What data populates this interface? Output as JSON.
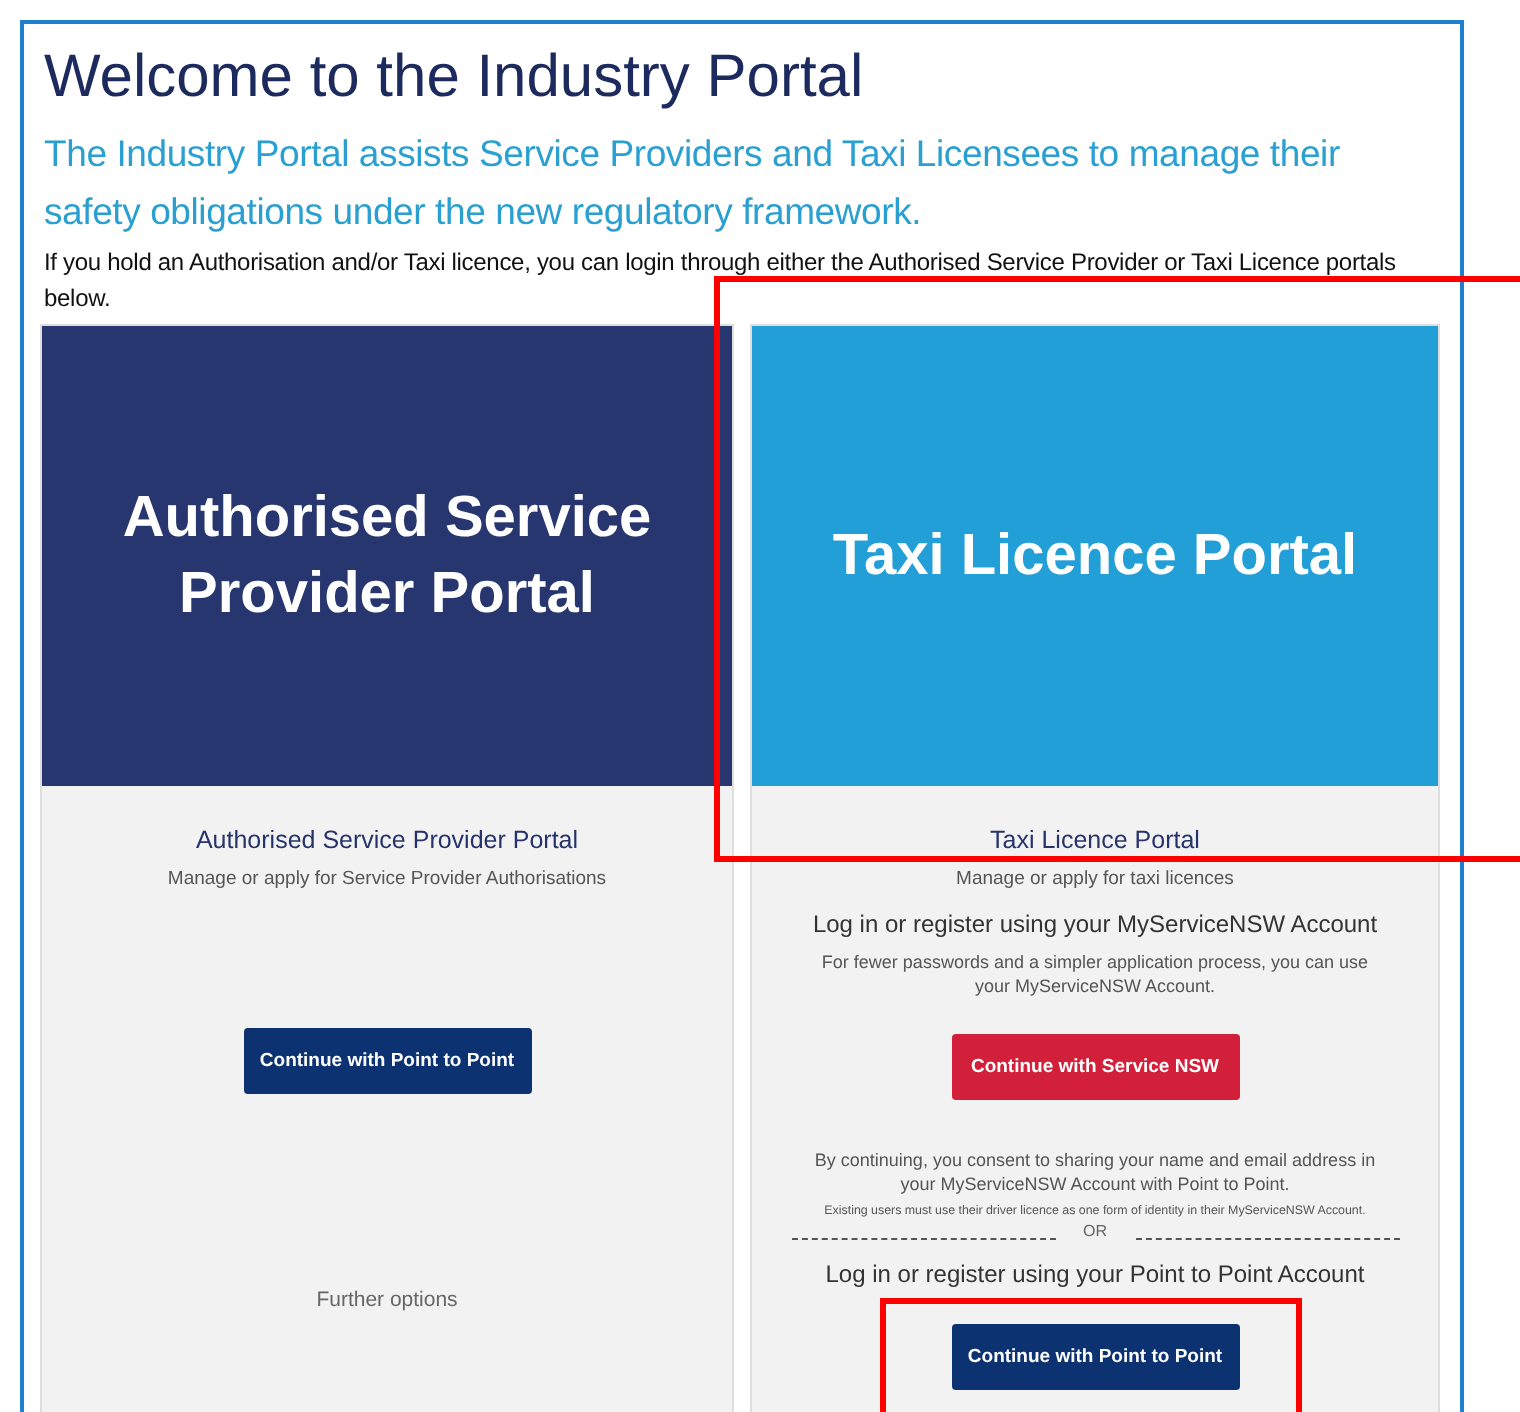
{
  "page": {
    "title": "Welcome to the Industry Portal",
    "subtitle": "The Industry Portal assists Service Providers and Taxi Licensees to manage their safety obligations under the new regulatory framework.",
    "intro": "If you hold an Authorisation and/or Taxi licence, you can login through either the Authorised Service Provider or Taxi Licence portals below."
  },
  "portals": [
    {
      "banner": "Authorised Service Provider Portal",
      "color": "#283670",
      "heading": "Authorised Service Provider Portal",
      "description": "Manage or apply for Service Provider Authorisations",
      "blocks": [
        {
          "kind": "button",
          "text": "Continue with Point to Point",
          "color": "#0d3272"
        },
        {
          "kind": "link",
          "text": "Further options"
        }
      ]
    },
    {
      "banner": "Taxi Licence Portal",
      "color": "#239fd8",
      "heading": "Taxi Licence Portal",
      "description": "Manage or apply for taxi licences",
      "blocks": [
        {
          "kind": "heading",
          "text": "Log in or register using your MyServiceNSW Account"
        },
        {
          "kind": "text",
          "text": "For fewer passwords and a simpler application process, you can use your MyServiceNSW Account."
        },
        {
          "kind": "button",
          "text": "Continue with Service NSW",
          "color": "#d21f3a"
        },
        {
          "kind": "text",
          "text": "By continuing, you consent to sharing your name and email address in your MyServiceNSW Account with Point to Point."
        },
        {
          "kind": "small",
          "text": "Existing users must use their driver licence as one form of identity in their MyServiceNSW Account."
        },
        {
          "kind": "divider",
          "text": "OR"
        },
        {
          "kind": "heading",
          "text": "Log in or register using your Point to Point Account"
        },
        {
          "kind": "button",
          "text": "Continue with Point to Point",
          "color": "#0d3272"
        }
      ]
    }
  ]
}
